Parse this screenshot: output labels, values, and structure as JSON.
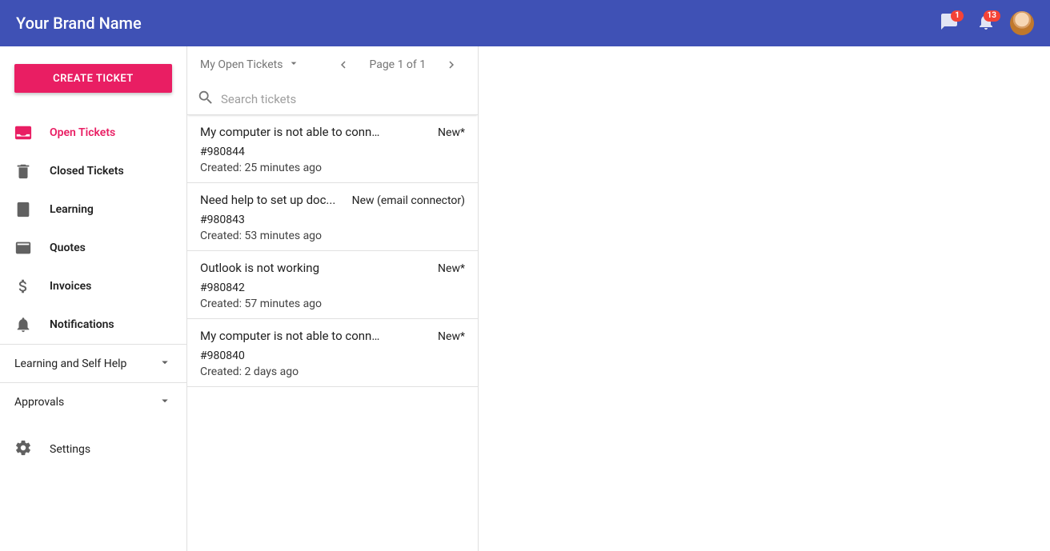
{
  "header": {
    "brand": "Your Brand Name",
    "chat_badge": "1",
    "notif_badge": "13"
  },
  "sidebar": {
    "create_label": "CREATE TICKET",
    "nav": [
      {
        "label": "Open Tickets"
      },
      {
        "label": "Closed Tickets"
      },
      {
        "label": "Learning"
      },
      {
        "label": "Quotes"
      },
      {
        "label": "Invoices"
      },
      {
        "label": "Notifications"
      }
    ],
    "expanders": [
      {
        "label": "Learning and Self Help"
      },
      {
        "label": "Approvals"
      }
    ],
    "settings_label": "Settings"
  },
  "ticket_col": {
    "filter_label": "My Open Tickets",
    "page_label": "Page 1 of 1",
    "search_placeholder": "Search tickets",
    "tickets": [
      {
        "title": "My computer is not able to connect to t...",
        "status": "New*",
        "number": "#980844",
        "created": "Created: 25 minutes ago"
      },
      {
        "title": "Need help to set up doc...",
        "status": "New (email connector)",
        "number": "#980843",
        "created": "Created: 53 minutes ago"
      },
      {
        "title": "Outlook is not working",
        "status": "New*",
        "number": "#980842",
        "created": "Created: 57 minutes ago"
      },
      {
        "title": "My computer is not able to connect to t...",
        "status": "New*",
        "number": "#980840",
        "created": "Created: 2 days ago"
      }
    ]
  }
}
